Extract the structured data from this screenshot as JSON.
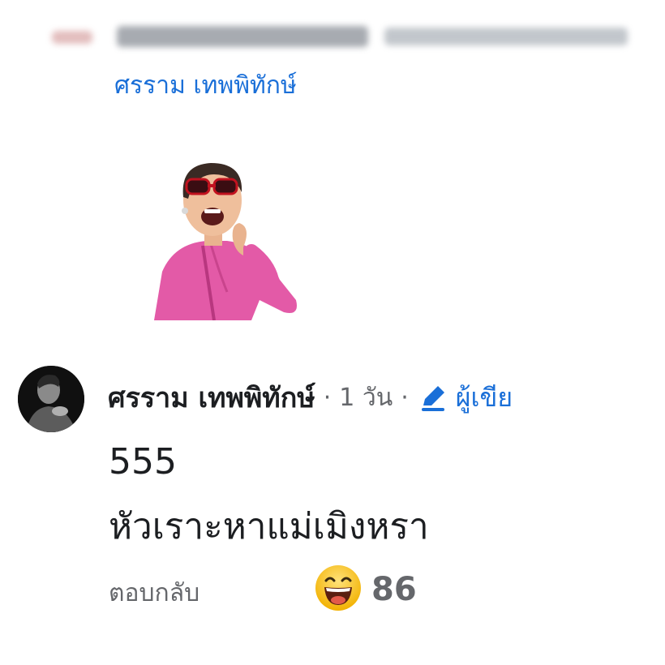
{
  "header": {
    "breadcrumb_blurred": true
  },
  "parent_reply": {
    "mention_name": "ศรราม เทพพิทักษ์"
  },
  "sticker": {
    "icon": "animated-avatar-sticker"
  },
  "comment": {
    "author": "ศรราม เทพพิทักษ์",
    "separator": "·",
    "time": "1 วัน",
    "author_badge": "ผู้เขีย",
    "badge_icon": "pencil-icon",
    "line1": "555",
    "line2": "หัวเราะหาแม่เมิงหรา",
    "reply_label": "ตอบกลับ",
    "reaction_icon": "haha-emoji-icon",
    "reaction_count": "86"
  },
  "colors": {
    "link_blue": "#1a6fd8",
    "text_dark": "#1c1e21",
    "text_muted": "#65676b",
    "haha_yellow": "#f7c531"
  }
}
